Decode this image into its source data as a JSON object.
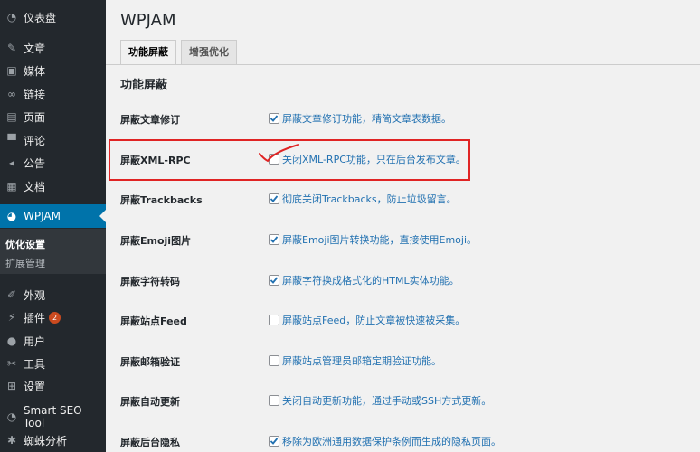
{
  "sidebar": {
    "items": [
      {
        "label": "仪表盘",
        "icon": "dashboard-icon"
      },
      {
        "label": "文章",
        "icon": "pin-icon"
      },
      {
        "label": "媒体",
        "icon": "media-icon"
      },
      {
        "label": "链接",
        "icon": "link-icon"
      },
      {
        "label": "页面",
        "icon": "page-icon"
      },
      {
        "label": "评论",
        "icon": "comment-icon"
      },
      {
        "label": "公告",
        "icon": "megaphone-icon"
      },
      {
        "label": "文档",
        "icon": "document-icon"
      },
      {
        "label": "WPJAM",
        "icon": "gauge-icon"
      },
      {
        "label": "外观",
        "icon": "brush-icon"
      },
      {
        "label": "插件",
        "icon": "plugin-icon",
        "badge": "2"
      },
      {
        "label": "用户",
        "icon": "user-icon"
      },
      {
        "label": "工具",
        "icon": "wrench-icon"
      },
      {
        "label": "设置",
        "icon": "settings-icon"
      },
      {
        "label": "Smart SEO Tool",
        "icon": "gauge-icon"
      },
      {
        "label": "蜘蛛分析",
        "icon": "spider-icon"
      }
    ],
    "submenu": [
      {
        "label": "优化设置"
      },
      {
        "label": "扩展管理"
      }
    ]
  },
  "main": {
    "title": "WPJAM",
    "tabs": [
      {
        "label": "功能屏蔽"
      },
      {
        "label": "增强优化"
      }
    ],
    "section_title": "功能屏蔽",
    "rows": [
      {
        "label": "屏蔽文章修订",
        "option": "屏蔽文章修订功能，精简文章表数据。",
        "checked": true
      },
      {
        "label": "屏蔽XML-RPC",
        "option": "关闭XML-RPC功能，只在后台发布文章。",
        "checked": false
      },
      {
        "label": "屏蔽Trackbacks",
        "option": "彻底关闭Trackbacks，防止垃圾留言。",
        "checked": true
      },
      {
        "label": "屏蔽Emoji图片",
        "option": "屏蔽Emoji图片转换功能，直接使用Emoji。",
        "checked": true
      },
      {
        "label": "屏蔽字符转码",
        "option": "屏蔽字符换成格式化的HTML实体功能。",
        "checked": true
      },
      {
        "label": "屏蔽站点Feed",
        "option": "屏蔽站点Feed，防止文章被快速被采集。",
        "checked": false
      },
      {
        "label": "屏蔽邮箱验证",
        "option": "屏蔽站点管理员邮箱定期验证功能。",
        "checked": false
      },
      {
        "label": "屏蔽自动更新",
        "option": "关闭自动更新功能，通过手动或SSH方式更新。",
        "checked": false
      },
      {
        "label": "屏蔽后台隐私",
        "option": "移除为欧洲通用数据保护条例而生成的隐私页面。",
        "checked": true
      }
    ]
  },
  "colors": {
    "sidebar_bg": "#23282d",
    "accent": "#0073aa",
    "link": "#2271b1",
    "annotation": "#e02424"
  }
}
